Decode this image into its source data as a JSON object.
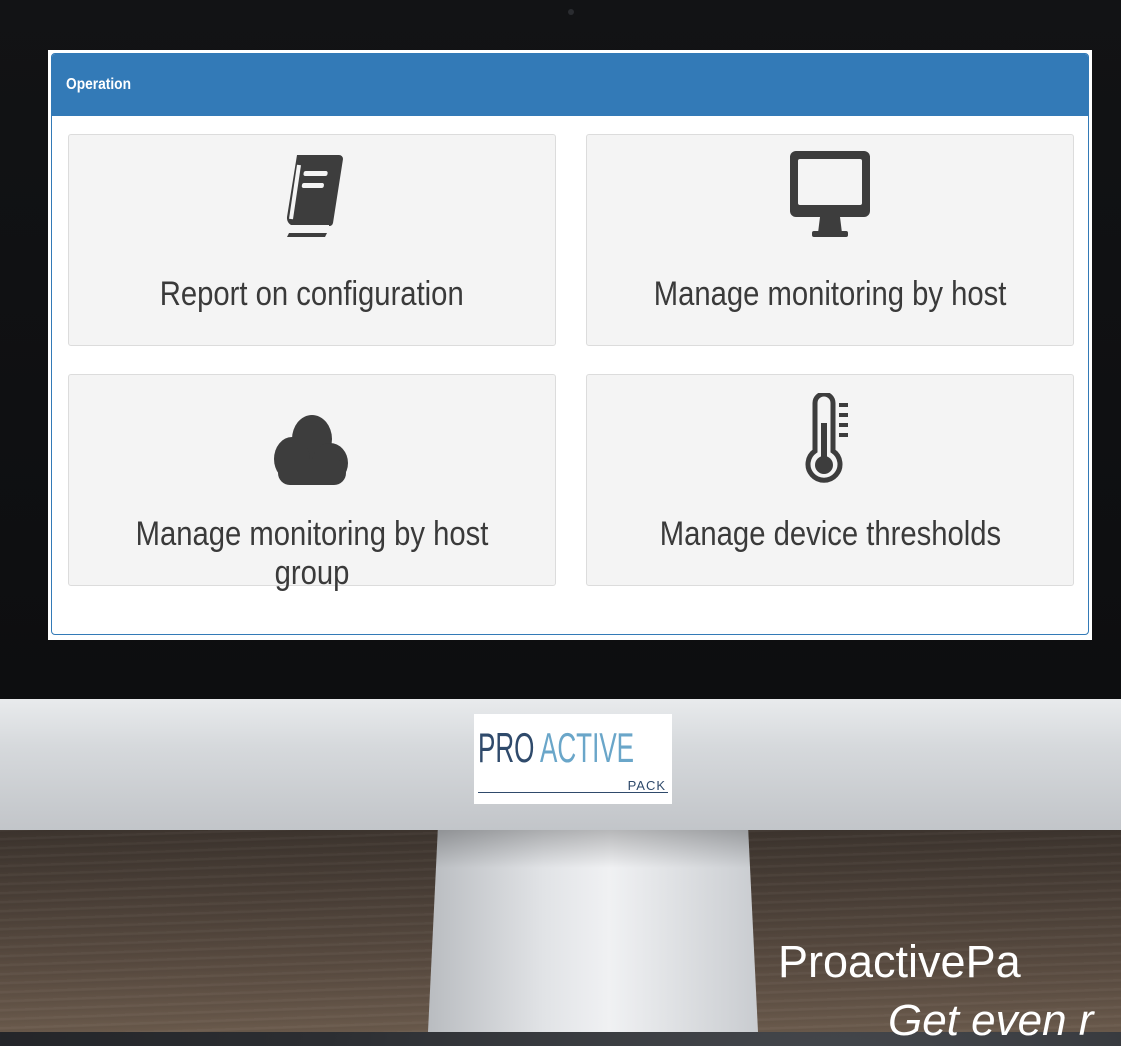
{
  "panel": {
    "title": "Operation",
    "tiles": [
      {
        "label": "Report on configuration",
        "icon": "book-icon"
      },
      {
        "label": "Manage monitoring by host",
        "icon": "desktop-icon"
      },
      {
        "label": "Manage monitoring by host group",
        "icon": "cloud-icon"
      },
      {
        "label": "Manage device thresholds",
        "icon": "thermometer-icon"
      }
    ]
  },
  "logo": {
    "pro": "PRO",
    "active": "ACTIVE",
    "pack": "PACK"
  },
  "brand": {
    "name": "ProactivePa",
    "tagline": "Get even r"
  },
  "colors": {
    "accent": "#337ab7",
    "tile_bg": "#f4f4f4",
    "icon": "#3d3d3d"
  }
}
